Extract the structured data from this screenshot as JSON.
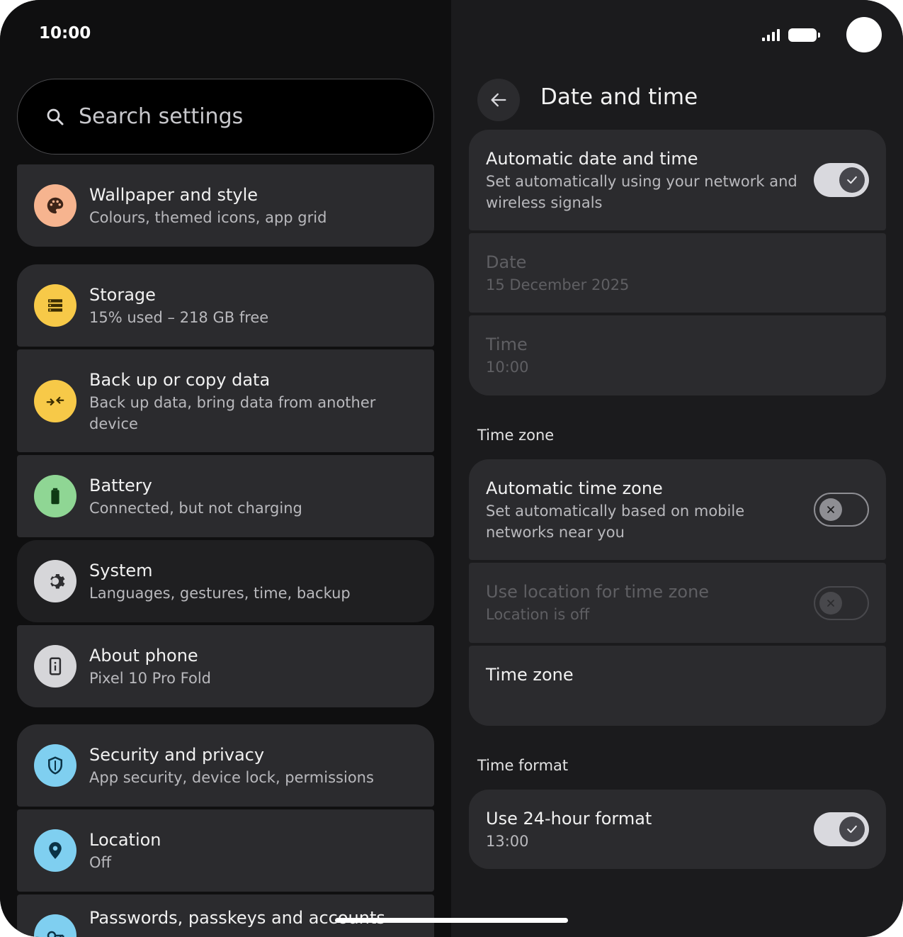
{
  "status": {
    "time": "10:00"
  },
  "search": {
    "placeholder": "Search settings"
  },
  "settings": [
    {
      "title": "Wallpaper and style",
      "sub": "Colours, themed icons, app grid",
      "icon": "palette-icon",
      "color": "#f6b48f"
    },
    {
      "title": "Storage",
      "sub": "15% used – 218 GB free",
      "icon": "storage-icon",
      "color": "#f7c948"
    },
    {
      "title": "Back up or copy data",
      "sub": "Back up data, bring data from another device",
      "icon": "backup-icon",
      "color": "#f7c948"
    },
    {
      "title": "Battery",
      "sub": "Connected, but not charging",
      "icon": "battery-icon",
      "color": "#8fd694"
    },
    {
      "title": "System",
      "sub": "Languages, gestures, time, backup",
      "icon": "gear-icon",
      "color": "#d6d6d9"
    },
    {
      "title": "About phone",
      "sub": "Pixel 10 Pro Fold",
      "icon": "phone-info-icon",
      "color": "#d6d6d9"
    },
    {
      "title": "Security and privacy",
      "sub": "App security, device lock, permissions",
      "icon": "shield-icon",
      "color": "#7fcff0"
    },
    {
      "title": "Location",
      "sub": "Off",
      "icon": "location-pin-icon",
      "color": "#7fcff0"
    },
    {
      "title": "Passwords, passkeys and accounts",
      "sub": "",
      "icon": "key-icon",
      "color": "#7fcff0"
    }
  ],
  "detail": {
    "title": "Date and time",
    "auto_date_time": {
      "title": "Automatic date and time",
      "sub": "Set automatically using your network and wireless signals",
      "on": true
    },
    "date": {
      "title": "Date",
      "sub": "15 December 2025"
    },
    "time": {
      "title": "Time",
      "sub": "10:00"
    },
    "time_zone_section": "Time zone",
    "auto_time_zone": {
      "title": "Automatic time zone",
      "sub": "Set automatically based on mobile networks near you",
      "on": false
    },
    "use_location": {
      "title": "Use location for time zone",
      "sub": "Location is off",
      "on": false
    },
    "time_zone": {
      "title": "Time zone"
    },
    "time_format_section": "Time format",
    "use_24_hour": {
      "title": "Use 24-hour format",
      "sub": "13:00",
      "on": true
    }
  },
  "colors": {
    "background": "#0f0f10",
    "card": "#2b2b2e",
    "right_pane": "#1b1b1d",
    "toggle_on": "#d9d9de"
  }
}
